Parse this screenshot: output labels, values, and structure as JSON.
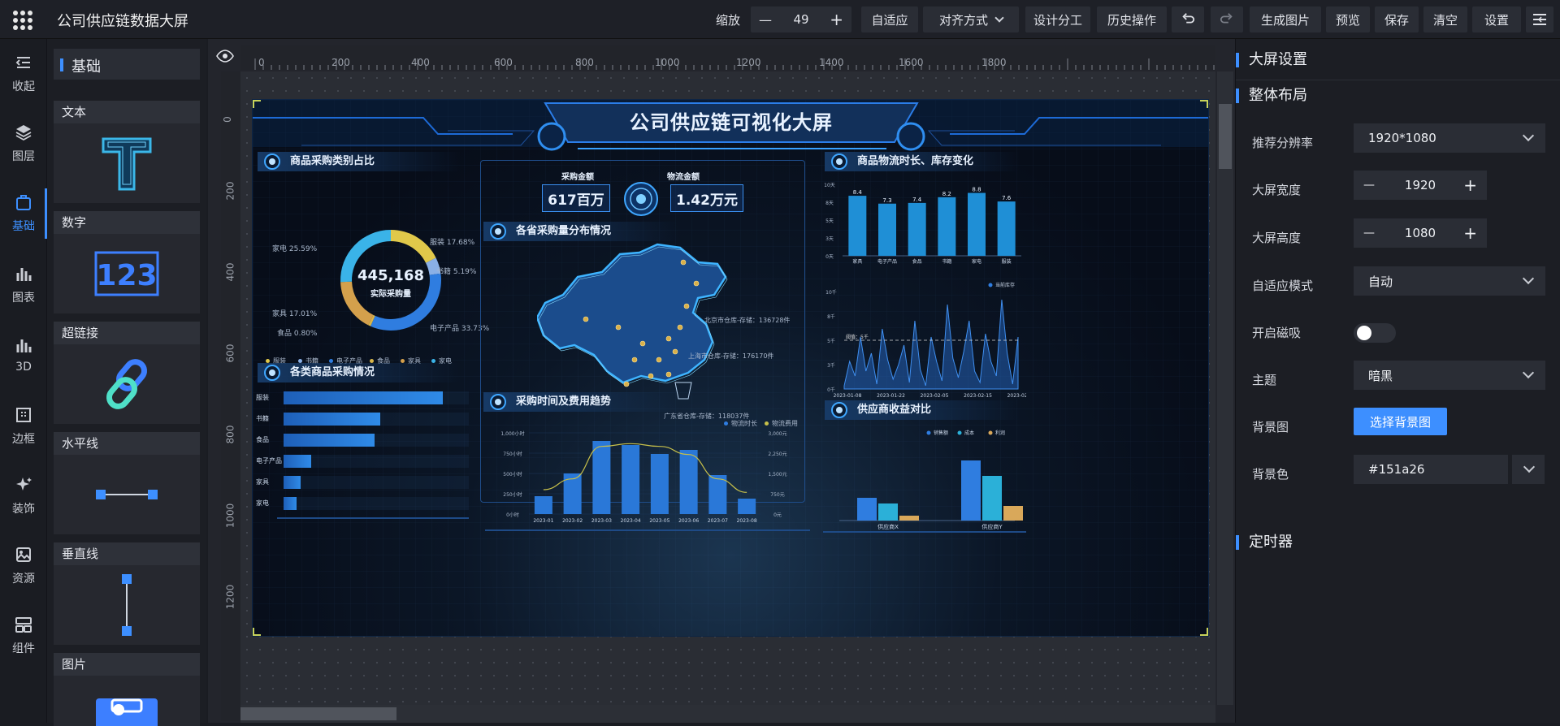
{
  "app": {
    "title": "公司供应链数据大屏"
  },
  "toolbar": {
    "zoom_label": "缩放",
    "zoom_minus": "—",
    "zoom_value": "49",
    "zoom_plus": "+",
    "auto_fit": "自适应",
    "align": "对齐方式",
    "design_division": "设计分工",
    "history": "历史操作",
    "generate_image": "生成图片",
    "preview": "预览",
    "save": "保存",
    "clear": "清空",
    "settings": "设置"
  },
  "left_rail": [
    {
      "label": "收起",
      "icon": "collapse-icon"
    },
    {
      "label": "图层",
      "icon": "layers-icon"
    },
    {
      "label": "基础",
      "icon": "basic-icon",
      "active": true
    },
    {
      "label": "图表",
      "icon": "chart-icon"
    },
    {
      "label": "3D",
      "icon": "3d-icon"
    },
    {
      "label": "边框",
      "icon": "border-icon"
    },
    {
      "label": "装饰",
      "icon": "decoration-icon"
    },
    {
      "label": "资源",
      "icon": "resource-icon"
    },
    {
      "label": "组件",
      "icon": "component-icon"
    }
  ],
  "palette": {
    "header": "基础",
    "items": [
      {
        "label": "文本",
        "icon": "text-T-icon"
      },
      {
        "label": "数字",
        "icon": "number-123-icon"
      },
      {
        "label": "超链接",
        "icon": "link-icon"
      },
      {
        "label": "水平线",
        "icon": "horizontal-line-icon"
      },
      {
        "label": "垂直线",
        "icon": "vertical-line-icon"
      },
      {
        "label": "图片",
        "icon": "image-icon"
      }
    ]
  },
  "ruler": {
    "h_labels": [
      "0",
      "200",
      "400",
      "600",
      "800",
      "1000",
      "1200",
      "1400",
      "1600",
      "1800"
    ],
    "v_labels": [
      "0",
      "200",
      "400",
      "600",
      "800",
      "1000",
      "1200"
    ]
  },
  "dashboard": {
    "title": "公司供应链可视化大屏",
    "donut": {
      "title": "商品采购类别占比",
      "center_value": "445,168",
      "center_label": "实际采购量",
      "labels": {
        "clothing": "服装 17.68%",
        "books": "书籍 5.19%",
        "electronics": "电子产品 33.73%",
        "food": "食品 0.80%",
        "home": "家具 17.01%",
        "appliance": "家电 25.59%"
      },
      "legend": [
        "服装",
        "书籍",
        "电子产品",
        "食品",
        "家具",
        "家电"
      ]
    },
    "hbars": {
      "title": "各类商品采购情况",
      "items": [
        {
          "label": "服装",
          "value": 0.86
        },
        {
          "label": "书籍",
          "value": 0.52
        },
        {
          "label": "食品",
          "value": 0.49
        },
        {
          "label": "电子产品",
          "value": 0.15
        },
        {
          "label": "家具",
          "value": 0.09
        },
        {
          "label": "家电",
          "value": 0.07
        }
      ]
    },
    "kpi": {
      "purchase_label": "采购金额",
      "purchase_value": "617百万",
      "logistics_label": "物流金额",
      "logistics_value": "1.42万元"
    },
    "map": {
      "title": "各省采购量分布情况",
      "annotations": {
        "beijing": "北京市仓库-存储：136728件",
        "shanghai": "上海市仓库-存储：176170件",
        "guangdong": "广东省仓库-存储：118037件"
      }
    },
    "trend": {
      "title": "采购时间及费用趋势",
      "legend_a": "物流时长",
      "legend_b": "物流费用",
      "x": [
        "2023-01",
        "2023-02",
        "2023-03",
        "2023-04",
        "2023-05",
        "2023-06",
        "2023-07",
        "2023-08"
      ],
      "y_left_ticks": [
        "1,000小时",
        "750小时",
        "500小时",
        "250小时",
        "0小时"
      ],
      "y_right_ticks": [
        "3,000元",
        "2,250元",
        "1,500元",
        "750元",
        "0元"
      ],
      "bars": [
        220,
        500,
        900,
        850,
        740,
        790,
        480,
        190
      ],
      "line": [
        0.9,
        1.3,
        2.5,
        2.6,
        2.5,
        2.2,
        1.3,
        0.8
      ]
    },
    "logistics": {
      "title": "商品物流时长、库存变化",
      "y_ticks": [
        "10天",
        "8天",
        "5天",
        "3天",
        "0天"
      ],
      "categories": [
        "家具",
        "电子产品",
        "食品",
        "书籍",
        "家电",
        "服装"
      ],
      "values": [
        8.4,
        7.3,
        7.4,
        8.2,
        8.8,
        7.6
      ],
      "value_labels": [
        "8.4",
        "7.3",
        "7.4",
        "8.2",
        "8.8",
        "7.6"
      ]
    },
    "inventory": {
      "legend": "当前库存",
      "y_ticks": [
        "10千",
        "8千",
        "5千",
        "3千",
        "0千"
      ],
      "x": [
        "2023-01-08",
        "2023-01-22",
        "2023-02-05",
        "2023-02-15",
        "2023-02-25"
      ],
      "threshold_label": "阈值：5千"
    },
    "supplier": {
      "title": "供应商收益对比",
      "legend": [
        "销售额",
        "成本",
        "利润"
      ],
      "groups": [
        {
          "name": "供应商X",
          "values": [
            0.28,
            0.21,
            0.06
          ]
        },
        {
          "name": "供应商Y",
          "values": [
            0.74,
            0.55,
            0.18
          ]
        }
      ]
    }
  },
  "right_panel": {
    "section_main": "大屏设置",
    "section_layout": "整体布局",
    "rows": [
      {
        "label": "推荐分辨率",
        "value": "1920*1080"
      },
      {
        "label": "大屏宽度",
        "value": "1920"
      },
      {
        "label": "大屏高度",
        "value": "1080"
      },
      {
        "label": "自适应模式",
        "value": "自动"
      },
      {
        "label": "开启磁吸",
        "value": ""
      },
      {
        "label": "主题",
        "value": "暗黑"
      },
      {
        "label": "背景图",
        "value": "选择背景图"
      },
      {
        "label": "背景色",
        "value": "#151a26"
      }
    ],
    "section_timer": "定时器",
    "minus": "—",
    "plus": "+"
  },
  "colors": {
    "accent": "#3d8fff",
    "bg": "#151a26"
  }
}
